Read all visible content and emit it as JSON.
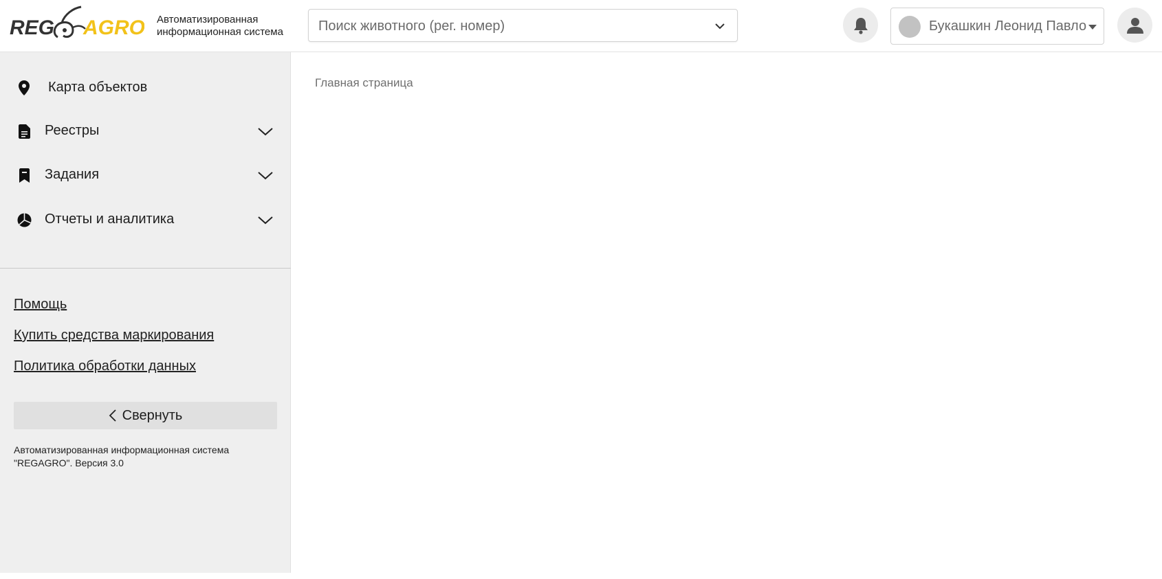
{
  "header": {
    "logo_text_left": "REG",
    "logo_text_right": "AGRO",
    "subtitle_line1": "Автоматизированная",
    "subtitle_line2": "информационная система",
    "search": {
      "placeholder": "Поиск животного (рег. номер)"
    },
    "icons": {
      "notifications": "bell-icon",
      "profile": "user-icon",
      "search_dropdown": "chevron-down-icon"
    },
    "user": {
      "name": "Букашкин Леонид Павло"
    }
  },
  "sidebar": {
    "items": [
      {
        "label": "Карта объектов",
        "icon": "map-marker-icon",
        "expandable": false
      },
      {
        "label": "Реестры",
        "icon": "document-icon",
        "expandable": true
      },
      {
        "label": "Задания",
        "icon": "bookmark-icon",
        "expandable": true
      },
      {
        "label": "Отчеты и аналитика",
        "icon": "pie-chart-icon",
        "expandable": true
      }
    ],
    "links": [
      {
        "label": "Помощь"
      },
      {
        "label": "Купить средства маркирования"
      },
      {
        "label": "Политика обработки данных"
      }
    ],
    "collapse_label": "Свернуть",
    "footer_line1": "Автоматизированная информационная система",
    "footer_line2": "\"REGAGRO\". Версия 3.0"
  },
  "main": {
    "breadcrumb": "Главная страница"
  },
  "colors": {
    "logo_dark": "#333333",
    "logo_yellow": "#f2c21a",
    "sidebar_bg": "#efefef",
    "button_bg": "#e0e0e0"
  }
}
